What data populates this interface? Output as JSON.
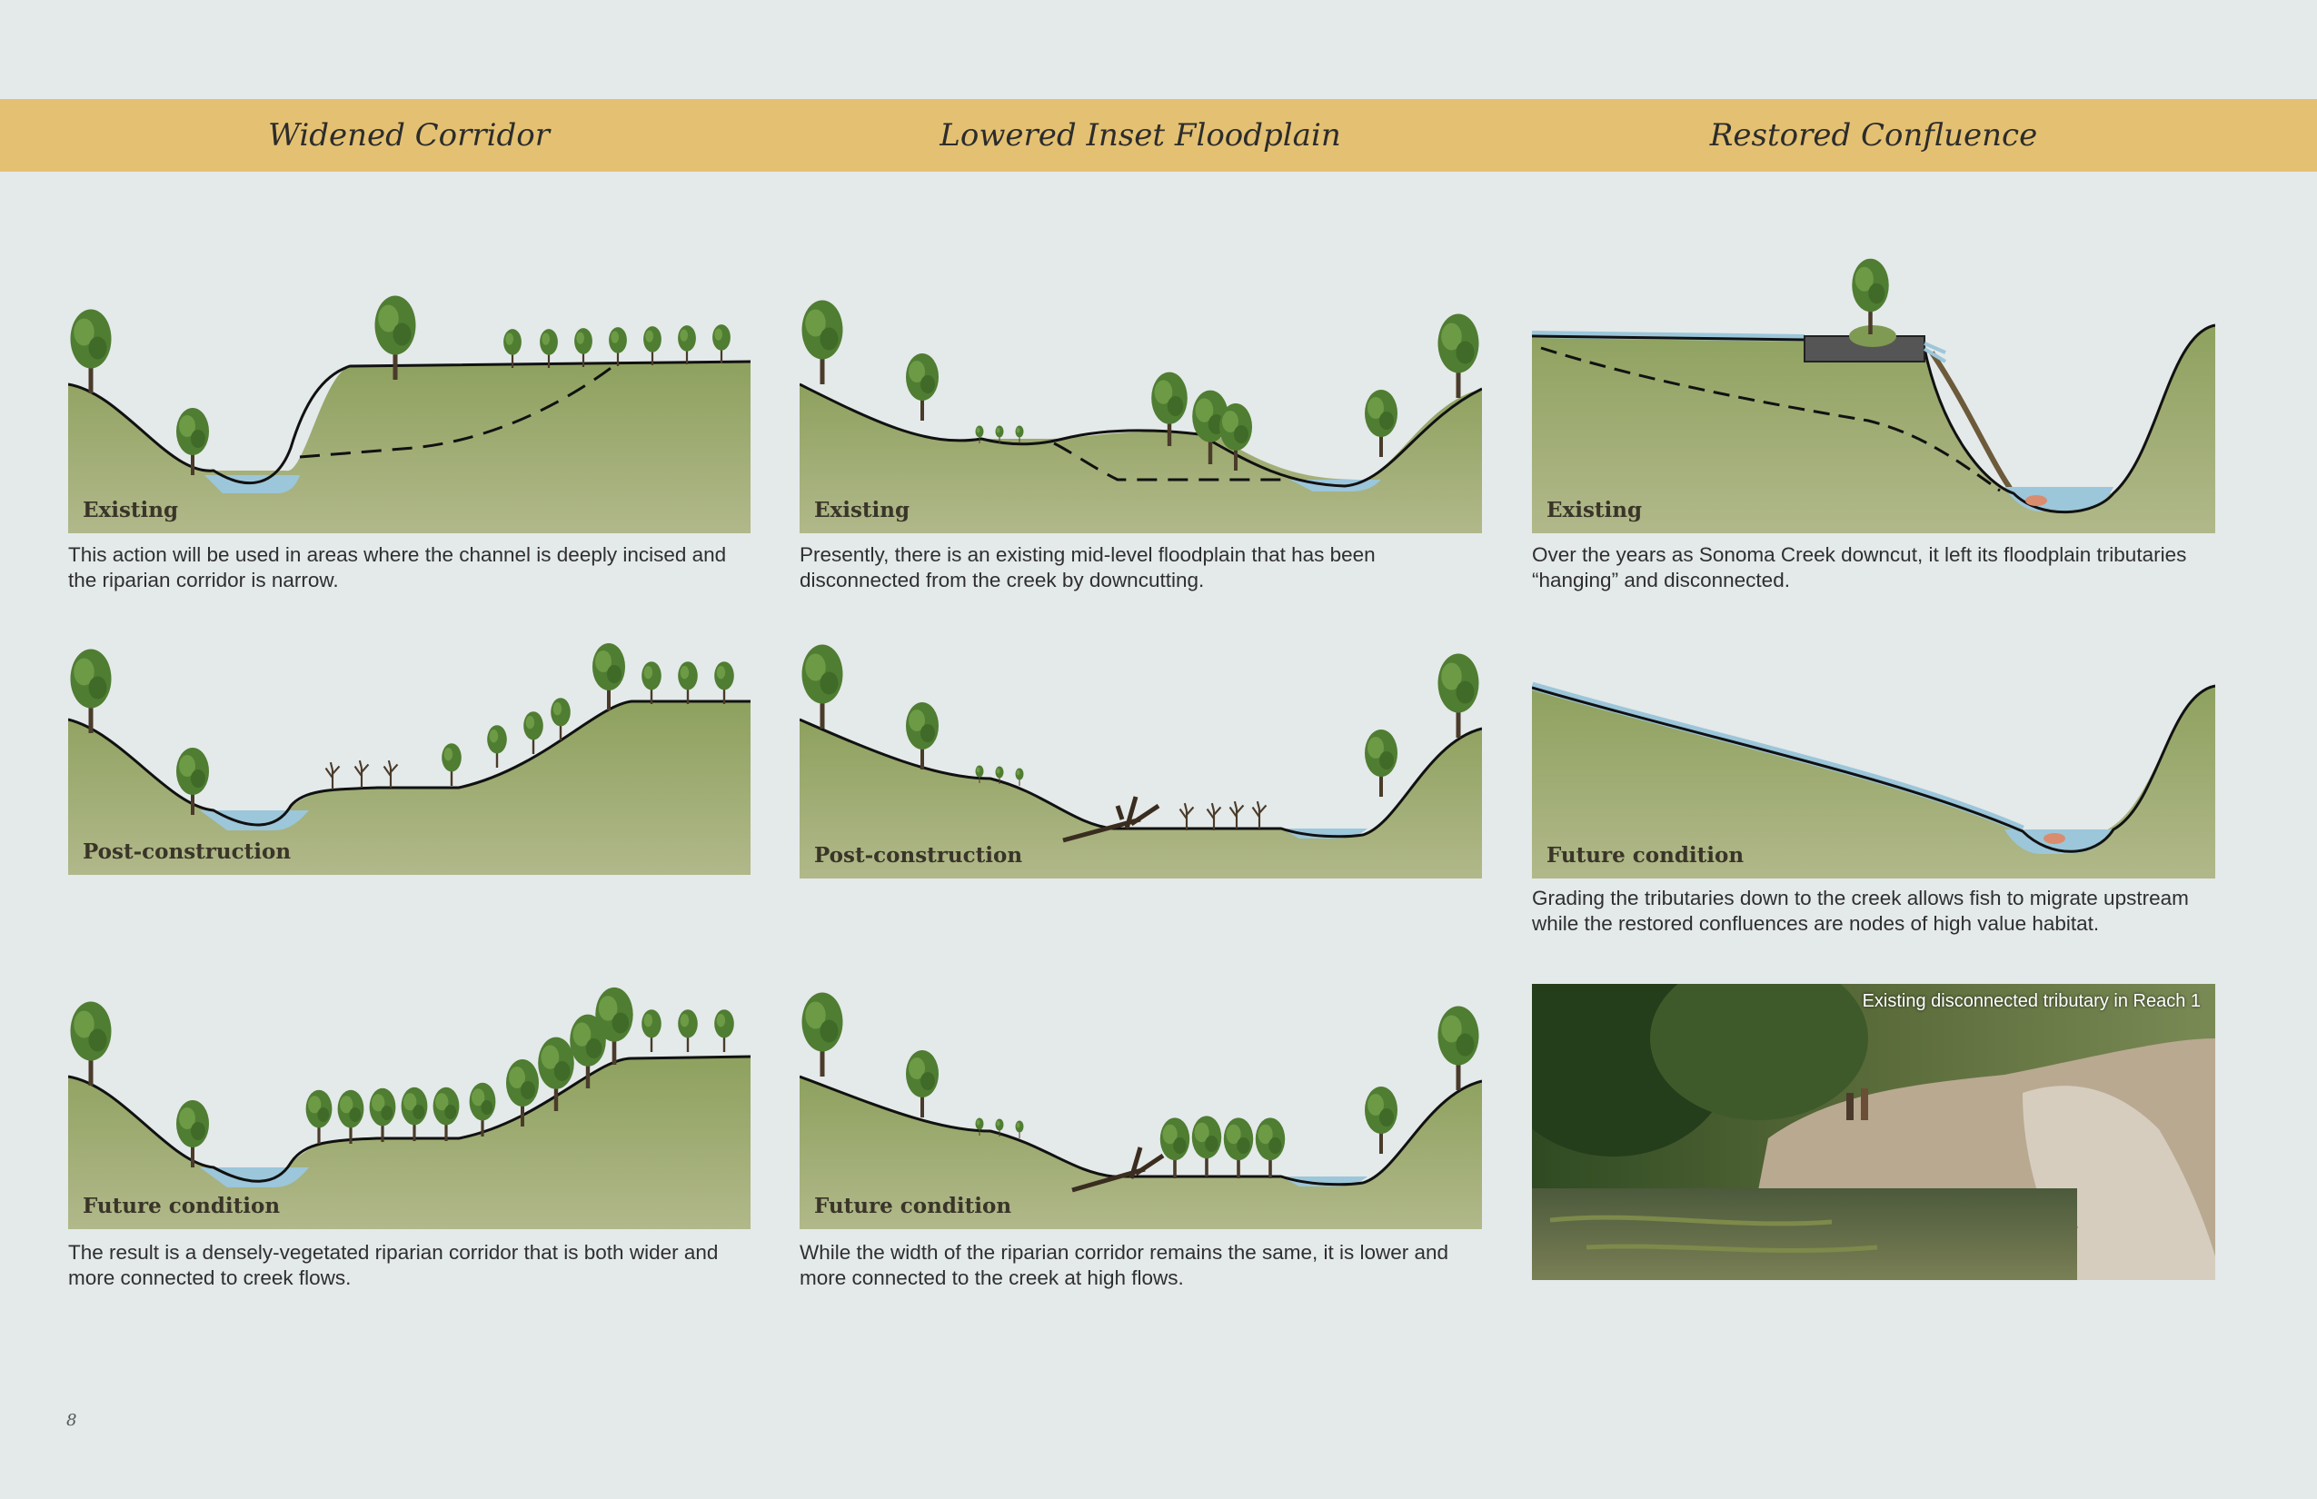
{
  "columns": [
    {
      "title": "Widened Corridor"
    },
    {
      "title": "Lowered Inset Floodplain"
    },
    {
      "title": "Restored Confluence"
    }
  ],
  "panels": {
    "wc_existing": "Existing",
    "wc_post": "Post-construction",
    "wc_future": "Future condition",
    "lf_existing": "Existing",
    "lf_post": "Post-construction",
    "lf_future": "Future condition",
    "rc_existing": "Existing",
    "rc_future": "Future condition"
  },
  "captions": {
    "wc_existing": "This action will be used in areas where the channel is deeply incised and the riparian corridor is narrow.",
    "wc_future": "The result is a densely-vegetated riparian corridor that is both wider and more connected to creek flows.",
    "lf_existing": "Presently, there is an existing mid-level floodplain that has been disconnected from the creek by downcutting.",
    "lf_future": "While the width of the riparian corridor remains the same, it is lower and more connected to the creek at high flows.",
    "rc_existing": "Over the years as Sonoma Creek downcut, it left its floodplain tributaries “hanging” and disconnected.",
    "rc_future": "Grading the tributaries down to the creek allows fish to migrate upstream while the restored confluences are nodes of high value habitat."
  },
  "photo": {
    "caption": "Existing disconnected tributary in Reach 1"
  },
  "page_number": "8",
  "colors": {
    "banner": "#e4c172",
    "ground": "#9aab6c",
    "water": "#9cc6da",
    "tree": "#4e7a32"
  }
}
